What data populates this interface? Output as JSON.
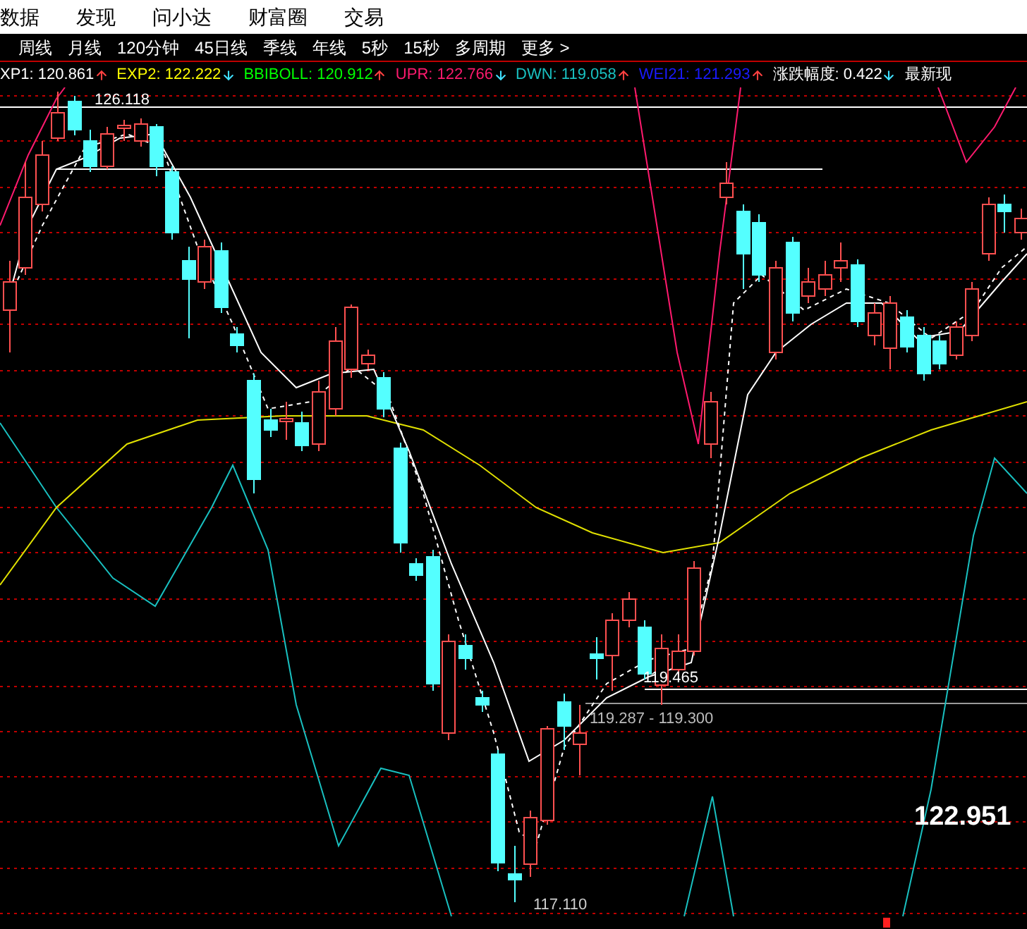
{
  "menu": [
    {
      "label": "数据"
    },
    {
      "label": "发现"
    },
    {
      "label": "问小达"
    },
    {
      "label": "财富圈"
    },
    {
      "label": "交易"
    }
  ],
  "periods": [
    {
      "label": "周线"
    },
    {
      "label": "月线"
    },
    {
      "label": "120分钟"
    },
    {
      "label": "45日线"
    },
    {
      "label": "季线"
    },
    {
      "label": "年线"
    },
    {
      "label": "5秒"
    },
    {
      "label": "15秒"
    },
    {
      "label": "多周期"
    },
    {
      "label": "更多 >"
    }
  ],
  "indicators": [
    {
      "label": "XP1: 120.861",
      "color": "#ffffff",
      "rising": true
    },
    {
      "label": "EXP2: 122.222",
      "color": "#ffff00",
      "rising": false
    },
    {
      "label": "BBIBOLL: 120.912",
      "color": "#00ff00",
      "rising": true
    },
    {
      "label": "UPR: 122.766",
      "color": "#ff1a6e",
      "rising": false
    },
    {
      "label": "DWN: 119.058",
      "color": "#19c0c0",
      "rising": true
    },
    {
      "label": "WEI21: 121.293",
      "color": "#1a1aff",
      "rising": true
    },
    {
      "label": "涨跌幅度: 0.422",
      "color": "#ffffff",
      "rising": false
    },
    {
      "label": "最新现",
      "color": "#ffffff"
    }
  ],
  "chart_labels": {
    "high": "126.118",
    "low": "117.110",
    "point": "119.465",
    "range": "119.287 - 119.300",
    "price": "122.951"
  }
}
